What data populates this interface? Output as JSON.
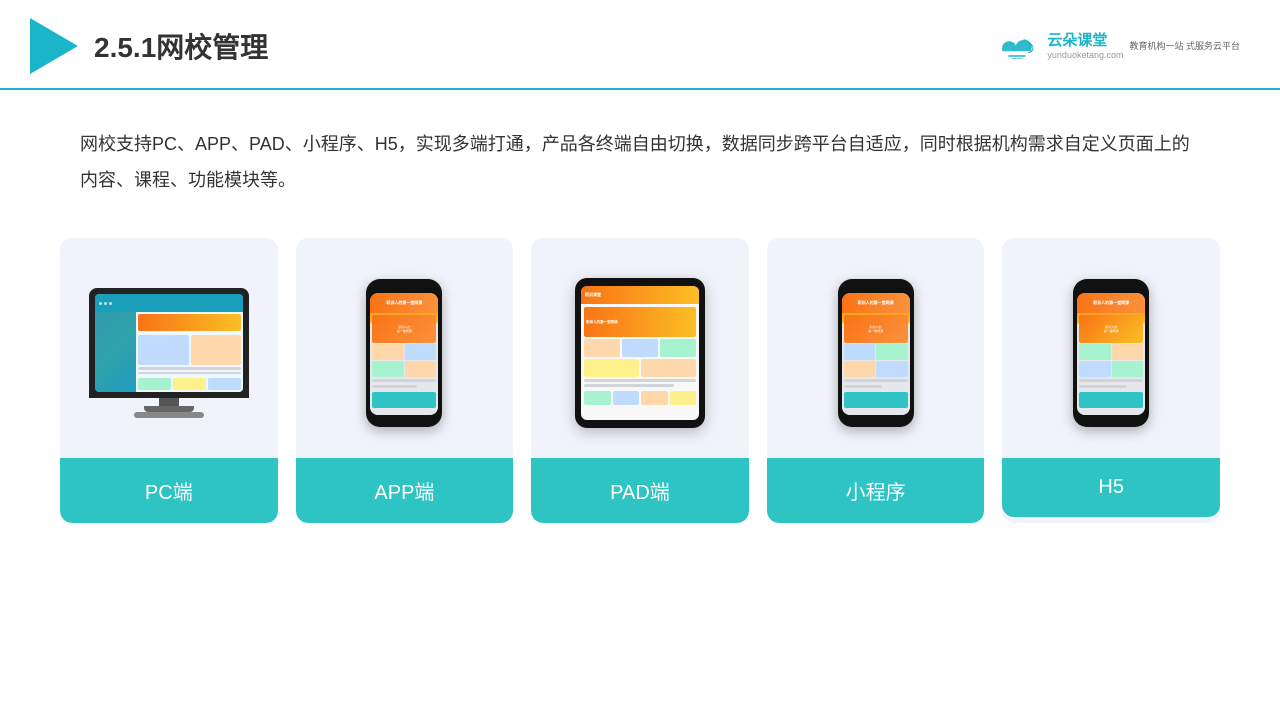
{
  "header": {
    "title": "2.5.1网校管理",
    "brand_name": "云朵课堂",
    "brand_url": "yunduoketang.com",
    "brand_slogan": "教育机构一站\n式服务云平台"
  },
  "description": {
    "text": "网校支持PC、APP、PAD、小程序、H5，实现多端打通，产品各终端自由切换，数据同步跨平台自适应，同时根据机构需求自定义页面上的内容、课程、功能模块等。"
  },
  "cards": [
    {
      "label": "PC端",
      "type": "pc"
    },
    {
      "label": "APP端",
      "type": "phone"
    },
    {
      "label": "PAD端",
      "type": "tablet"
    },
    {
      "label": "小程序",
      "type": "phone2"
    },
    {
      "label": "H5",
      "type": "phone3"
    }
  ]
}
